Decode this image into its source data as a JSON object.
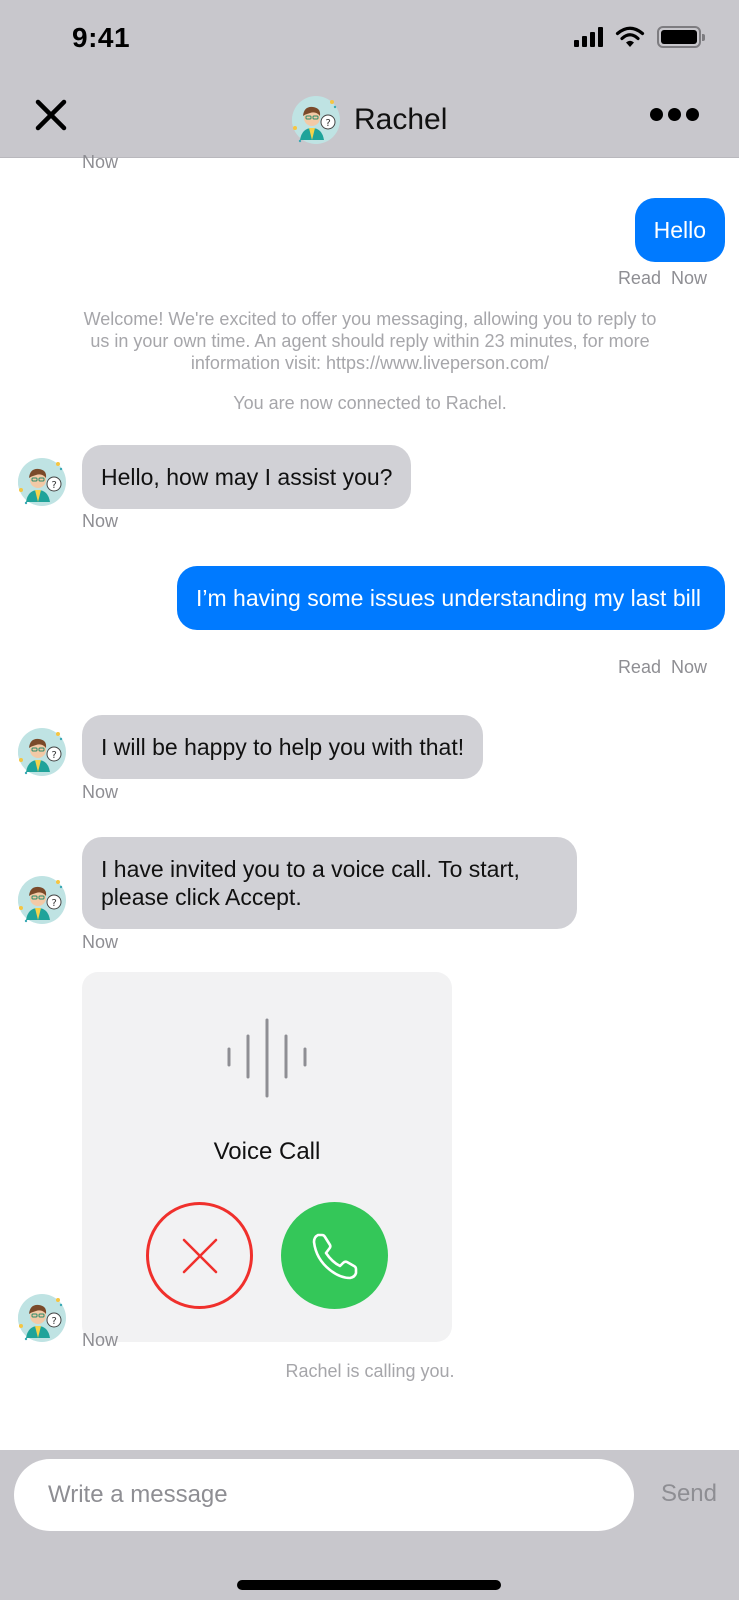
{
  "status_bar": {
    "time": "9:41"
  },
  "header": {
    "title": "Rachel",
    "close_icon": "close-icon",
    "more_icon": "more-horizontal-icon",
    "avatar": "agent-avatar"
  },
  "messages": {
    "top_timestamp": "Now",
    "m1": {
      "text": "Hello",
      "status": "Read",
      "time": "Now"
    },
    "welcome": "Welcome! We're excited to offer you messaging, allowing you to reply to us in your own time. An agent should reply within 23 minutes, for more information visit: https://www.liveperson.com/",
    "connected": "You are now connected to Rachel.",
    "m2": {
      "text": "Hello, how may I assist you?",
      "time": "Now"
    },
    "m3": {
      "text": "I’m having some issues understanding my last bill",
      "status": "Read",
      "time": "Now"
    },
    "m4": {
      "text": "I will be happy to help you with that!",
      "time": "Now"
    },
    "m5": {
      "text": "I have invited you to a voice call. To start, please click Accept.",
      "time": "Now"
    },
    "call": {
      "label": "Voice Call",
      "time": "Now",
      "decline_icon": "decline-x-icon",
      "accept_icon": "phone-icon"
    },
    "calling": "Rachel is calling you."
  },
  "composer": {
    "placeholder": "Write a message",
    "value": "",
    "send_label": "Send"
  },
  "colors": {
    "outgoing": "#007aff",
    "incoming": "#d1d1d6",
    "accept": "#34c759",
    "decline": "#f0302c",
    "bar": "#c8c7cc"
  }
}
